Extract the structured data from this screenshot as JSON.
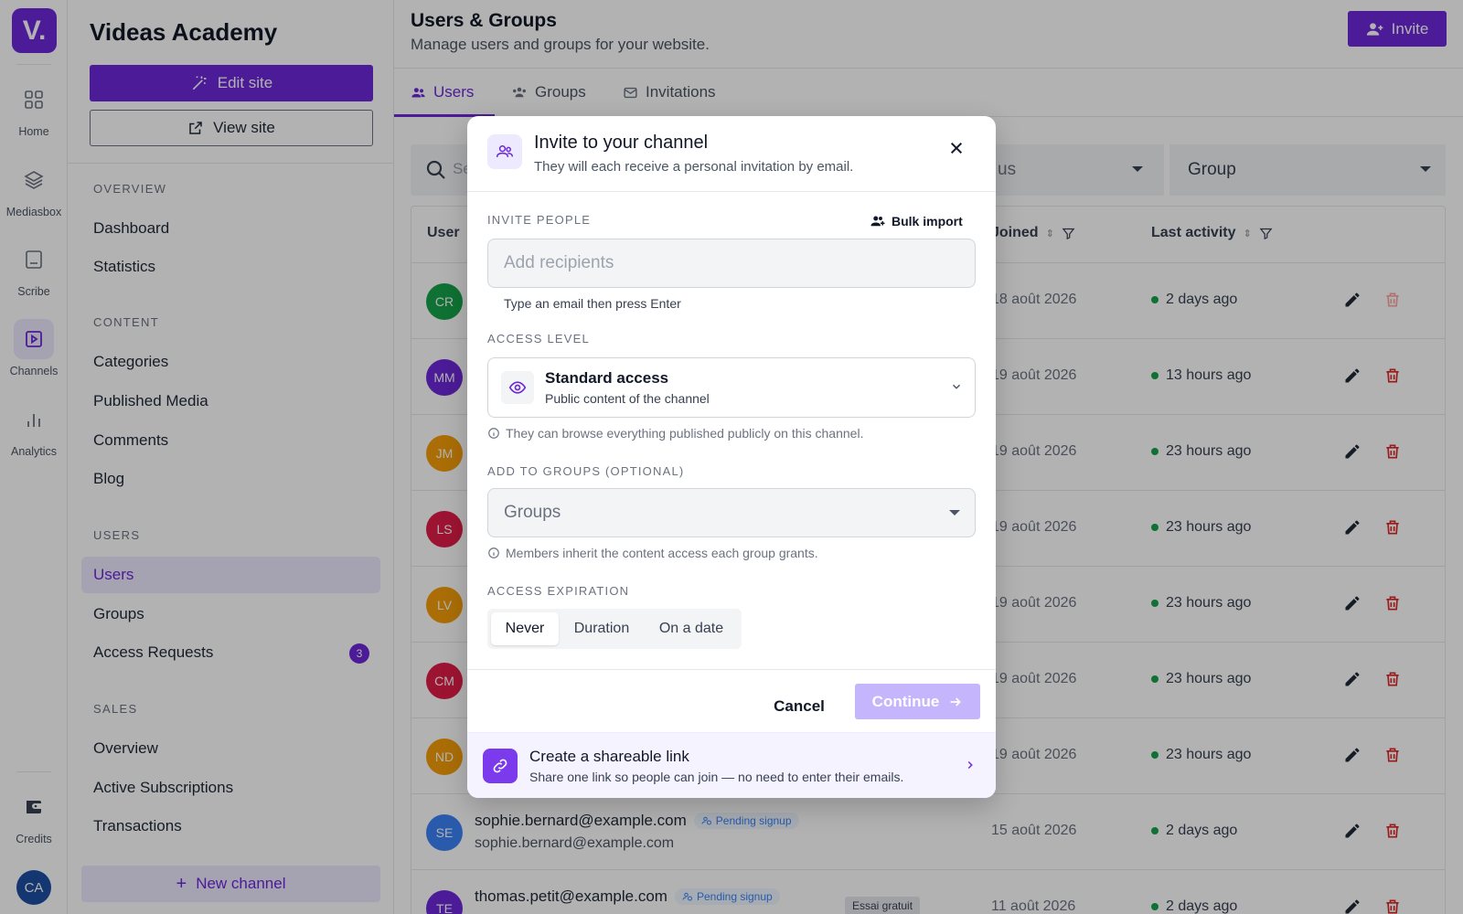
{
  "rail": {
    "logo": "V.",
    "items": [
      {
        "label": "Home",
        "icon": "grid-icon"
      },
      {
        "label": "Mediasbox",
        "icon": "layers-icon"
      },
      {
        "label": "Scribe",
        "icon": "scribe-icon"
      },
      {
        "label": "Channels",
        "icon": "play-square-icon",
        "active": true
      },
      {
        "label": "Analytics",
        "icon": "bar-chart-icon"
      },
      {
        "label": "Credits",
        "icon": "wallet-icon"
      }
    ],
    "user_initials": "CA"
  },
  "sidebar": {
    "site_name": "Videas Academy",
    "edit_site": "Edit site",
    "view_site": "View site",
    "sections": {
      "overview": "OVERVIEW",
      "content": "CONTENT",
      "users": "USERS",
      "sales": "SALES"
    },
    "items": {
      "dashboard": "Dashboard",
      "statistics": "Statistics",
      "categories": "Categories",
      "published_media": "Published Media",
      "comments": "Comments",
      "blog": "Blog",
      "users": "Users",
      "groups": "Groups",
      "access_requests": "Access Requests",
      "sales_overview": "Overview",
      "active_subscriptions": "Active Subscriptions",
      "transactions": "Transactions"
    },
    "access_requests_count": "3",
    "new_channel": "New channel"
  },
  "main": {
    "title": "Users & Groups",
    "subtitle": "Manage users and groups for your website.",
    "invite_button": "Invite",
    "tabs": [
      "Users",
      "Groups",
      "Invitations"
    ],
    "search_placeholder": "Se",
    "status_placeholder": "us",
    "group_placeholder": "Group",
    "columns": {
      "user": "User",
      "joined": "Joined",
      "last_activity": "Last activity"
    },
    "rows": [
      {
        "initials": "CR",
        "color": "#16a34a",
        "joined": "18 août 2026",
        "activity": "2 days ago",
        "delete_disabled": true
      },
      {
        "initials": "MM",
        "color": "#6d28d9",
        "joined": "19 août 2026",
        "activity": "13 hours ago"
      },
      {
        "initials": "JM",
        "color": "#f59e0b",
        "joined": "19 août 2026",
        "activity": "23 hours ago"
      },
      {
        "initials": "LS",
        "color": "#e11d48",
        "joined": "19 août 2026",
        "activity": "23 hours ago"
      },
      {
        "initials": "LV",
        "color": "#f59e0b",
        "joined": "19 août 2026",
        "activity": "23 hours ago"
      },
      {
        "initials": "CM",
        "color": "#e11d48",
        "joined": "19 août 2026",
        "activity": "23 hours ago"
      },
      {
        "initials": "ND",
        "color": "#f59e0b",
        "joined": "19 août 2026",
        "activity": "23 hours ago"
      },
      {
        "initials": "SE",
        "color": "#3b82f6",
        "name": "sophie.bernard@example.com",
        "email": "sophie.bernard@example.com",
        "pending": "Pending signup",
        "joined": "15 août 2026",
        "activity": "2 days ago"
      },
      {
        "initials": "TE",
        "color": "#6d28d9",
        "name": "thomas.petit@example.com",
        "pending": "Pending signup",
        "trial": "Essai gratuit",
        "joined": "11 août 2026",
        "activity": "2 days ago"
      }
    ]
  },
  "modal": {
    "title": "Invite to your channel",
    "subtitle": "They will each receive a personal invitation by email.",
    "invite_people_label": "INVITE PEOPLE",
    "bulk_import": "Bulk import",
    "recipients_placeholder": "Add recipients",
    "recipients_hint": "Type an email then press Enter",
    "access_level_label": "ACCESS LEVEL",
    "access_title": "Standard access",
    "access_desc": "Public content of the channel",
    "access_info": "They can browse everything published publicly on this channel.",
    "groups_label": "ADD TO GROUPS (OPTIONAL)",
    "groups_placeholder": "Groups",
    "groups_info": "Members inherit the content access each group grants.",
    "expiration_label": "ACCESS EXPIRATION",
    "expiration_options": [
      "Never",
      "Duration",
      "On a date"
    ],
    "expiration_selected": "Never",
    "cancel": "Cancel",
    "continue": "Continue",
    "share_title": "Create a shareable link",
    "share_desc": "Share one link so people can join — no need to enter their emails."
  },
  "colors": {
    "accent": "#6d28d9",
    "accent_light": "#ede9fe",
    "danger": "#dc2626",
    "success": "#16a34a"
  }
}
